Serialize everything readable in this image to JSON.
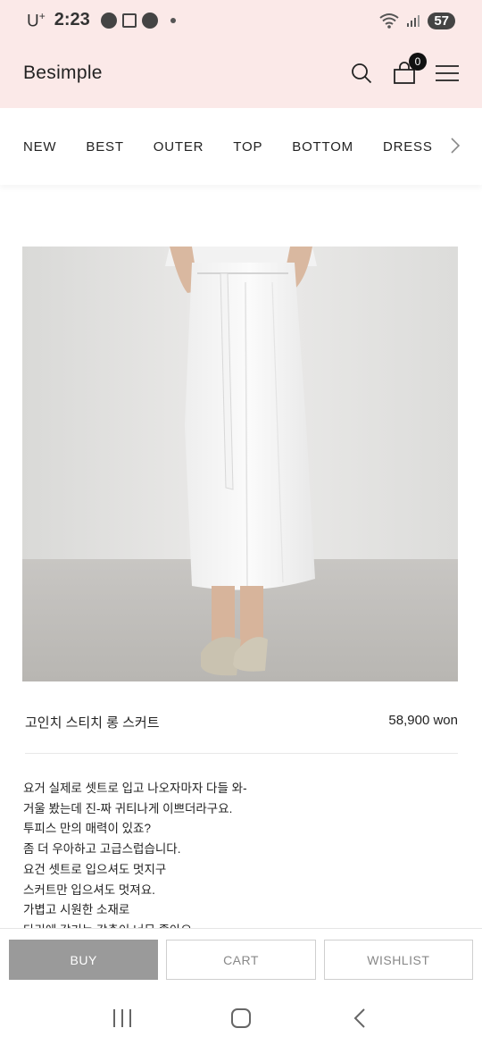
{
  "status_bar": {
    "carrier": "U",
    "carrier_sup": "+",
    "time": "2:23",
    "battery": "57"
  },
  "header": {
    "logo": "Besimple",
    "cart_count": "0"
  },
  "categories": [
    "NEW",
    "BEST",
    "OUTER",
    "TOP",
    "BOTTOM",
    "DRESS"
  ],
  "product": {
    "name": "고인치 스티치 롱 스커트",
    "price": "58,900 won",
    "description": [
      "요거 실제로 셋트로 입고 나오자마자 다들 와-",
      "거울 봤는데 진-짜 귀티나게 이쁘더라구요.",
      "투피스 만의 매력이 있죠?",
      "좀 더 우아하고 고급스럽습니다.",
      "요건 셋트로 입으셔도 멋지구",
      "스커트만 입으셔도 멋져요.",
      "가볍고 시원한 소재로",
      "다리에 감기는 감촉이 너무 좋아요."
    ]
  },
  "actions": {
    "buy": "BUY",
    "cart": "CART",
    "wishlist": "WISHLIST"
  },
  "colors": {
    "header_bg": "#fbe9e8",
    "buy_bg": "#9a9a9a"
  },
  "icons": [
    "search-icon",
    "shopping-bag-icon",
    "hamburger-menu-icon",
    "chevron-right-icon",
    "recents-icon",
    "home-icon",
    "back-icon"
  ]
}
